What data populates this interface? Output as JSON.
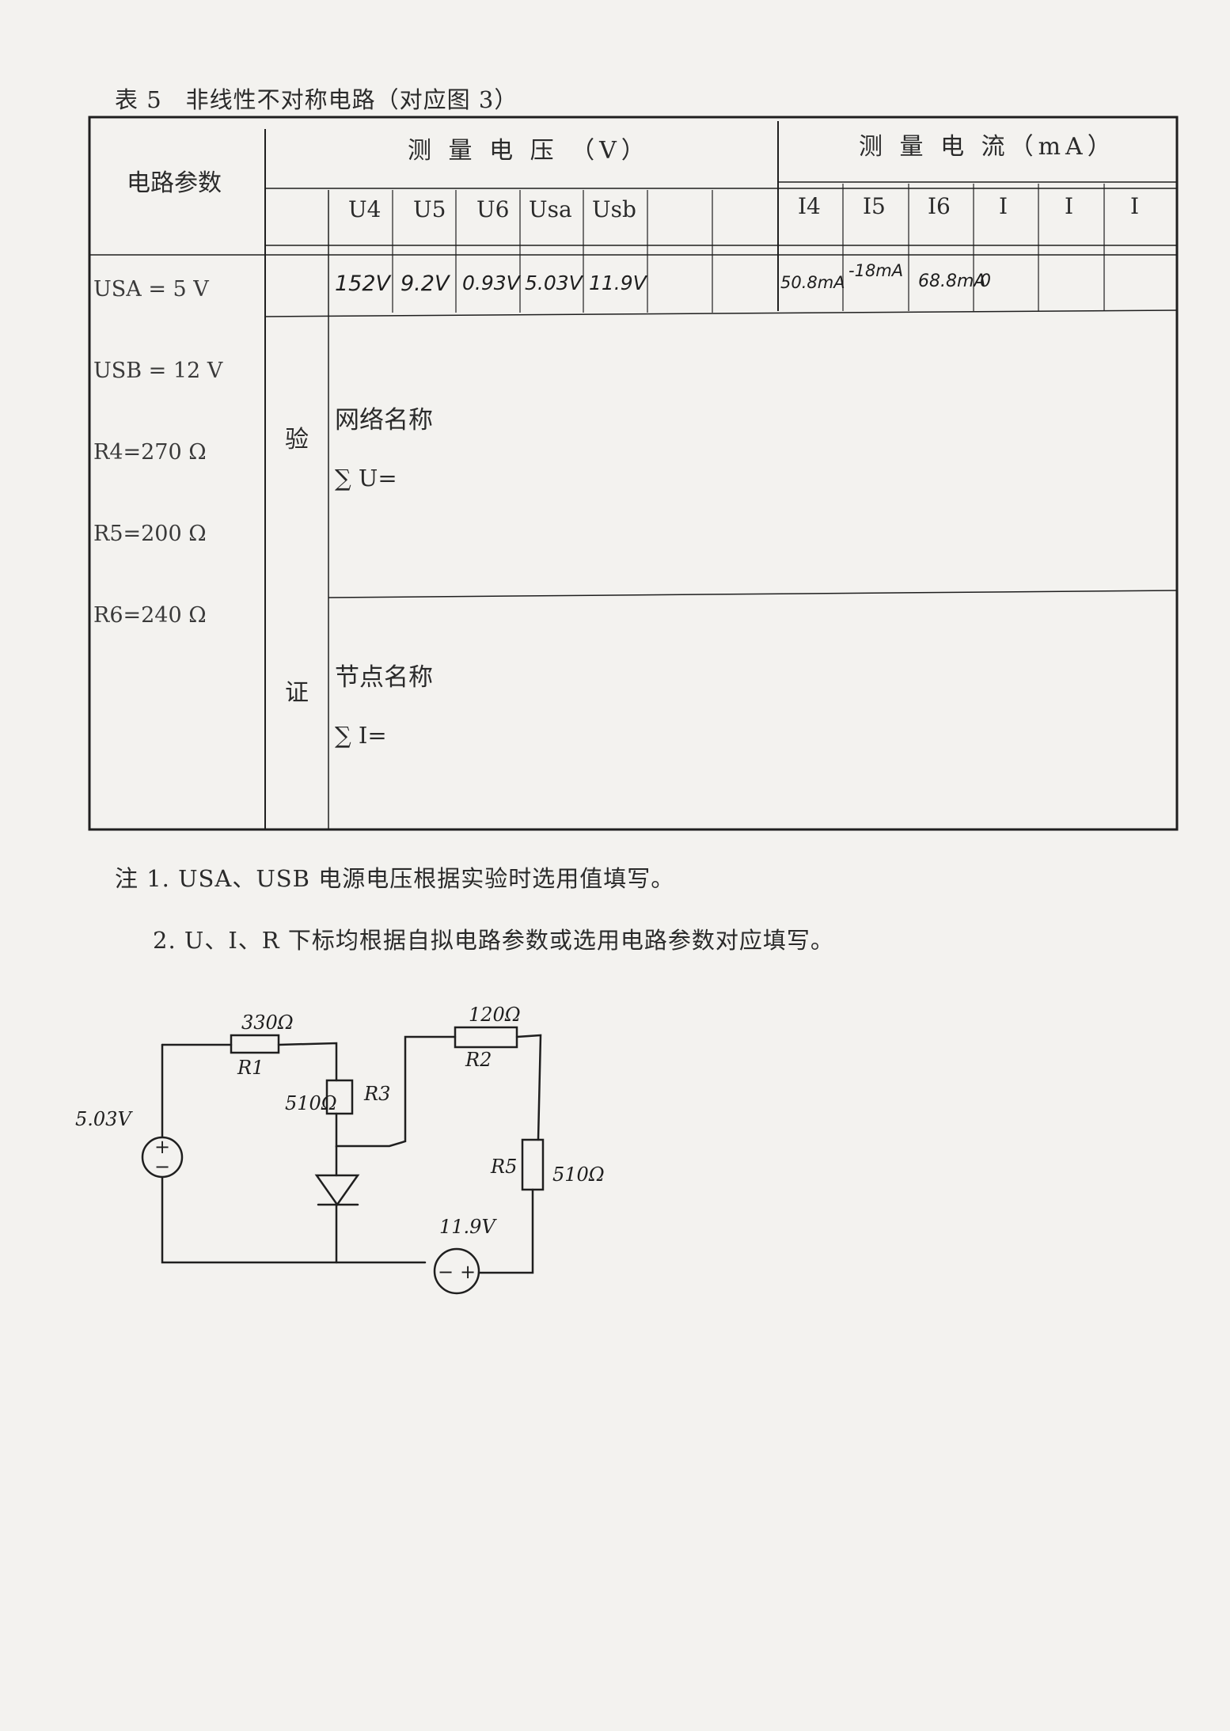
{
  "caption": "表 5　非线性不对称电路（对应图 3）",
  "table": {
    "param_header": "电路参数",
    "voltage_header": "测 量 电 压 （V）",
    "current_header": "测 量 电 流（mA）",
    "voltage_cols": [
      "U4",
      "U5",
      "U6",
      "Usa",
      "Usb",
      "",
      ""
    ],
    "current_cols": [
      "I4",
      "I5",
      "I6",
      "I",
      "I",
      "I"
    ],
    "voltage_values": [
      "152V",
      "9.2V",
      "0.93V",
      "5.03V",
      "11.9V",
      "",
      ""
    ],
    "current_values": [
      "50.8mA",
      "-18mA",
      "68.8mA",
      "0",
      "",
      ""
    ],
    "params": [
      "USA = 5 V",
      "USB = 12 V",
      "R4=270 Ω",
      "R5=200 Ω",
      "R6=240 Ω"
    ],
    "verify_top": "验",
    "verify_bottom": "证",
    "loop_label": "网络名称",
    "loop_sum": "∑ U=",
    "node_label": "节点名称",
    "node_sum": "∑ I="
  },
  "notes": [
    "注 1. USA、USB 电源电压根据实验时选用值填写。",
    "2. U、I、R 下标均根据自拟电路参数或选用电路参数对应填写。"
  ],
  "circuit": {
    "r1_value": "330Ω",
    "r1_label": "R1",
    "r2_value": "120Ω",
    "r2_label": "R2",
    "r3_value": "510Ω",
    "r3_label": "R3",
    "r5_value": "510Ω",
    "r5_label": "R5",
    "source_a_value": "5.03V",
    "source_b_value": "11.9V"
  }
}
